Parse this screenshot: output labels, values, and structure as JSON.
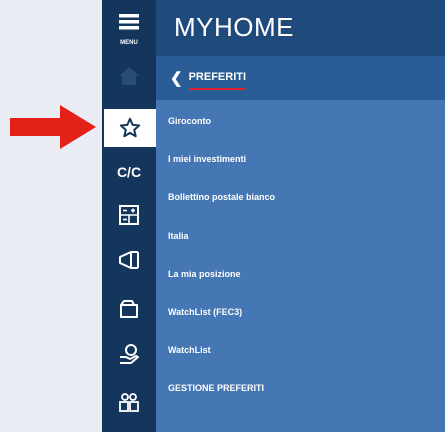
{
  "app": {
    "title": "MYHOME"
  },
  "rail": {
    "menu_label": "MENU",
    "items": [
      {
        "icon": "home-icon"
      },
      {
        "icon": "star-icon",
        "active": true
      },
      {
        "icon": "cc-icon",
        "label": "C/C"
      },
      {
        "icon": "calculator-icon"
      },
      {
        "icon": "megaphone-icon"
      },
      {
        "icon": "folder-icon"
      },
      {
        "icon": "coins-hand-icon"
      },
      {
        "icon": "people-icon"
      }
    ]
  },
  "panel": {
    "back_label": "PREFERITI",
    "favorites": [
      "Giroconto",
      "I miei investimenti",
      "Bollettino postale bianco",
      "Italia",
      "La mia posizione",
      "WatchList (FEC3)",
      "WatchList",
      "GESTIONE PREFERITI"
    ]
  },
  "colors": {
    "rail": "#14365c",
    "header": "#1e4b7c",
    "panel": "#4477b3",
    "back_row": "#2a5c95",
    "accent_red": "#e0232b"
  }
}
